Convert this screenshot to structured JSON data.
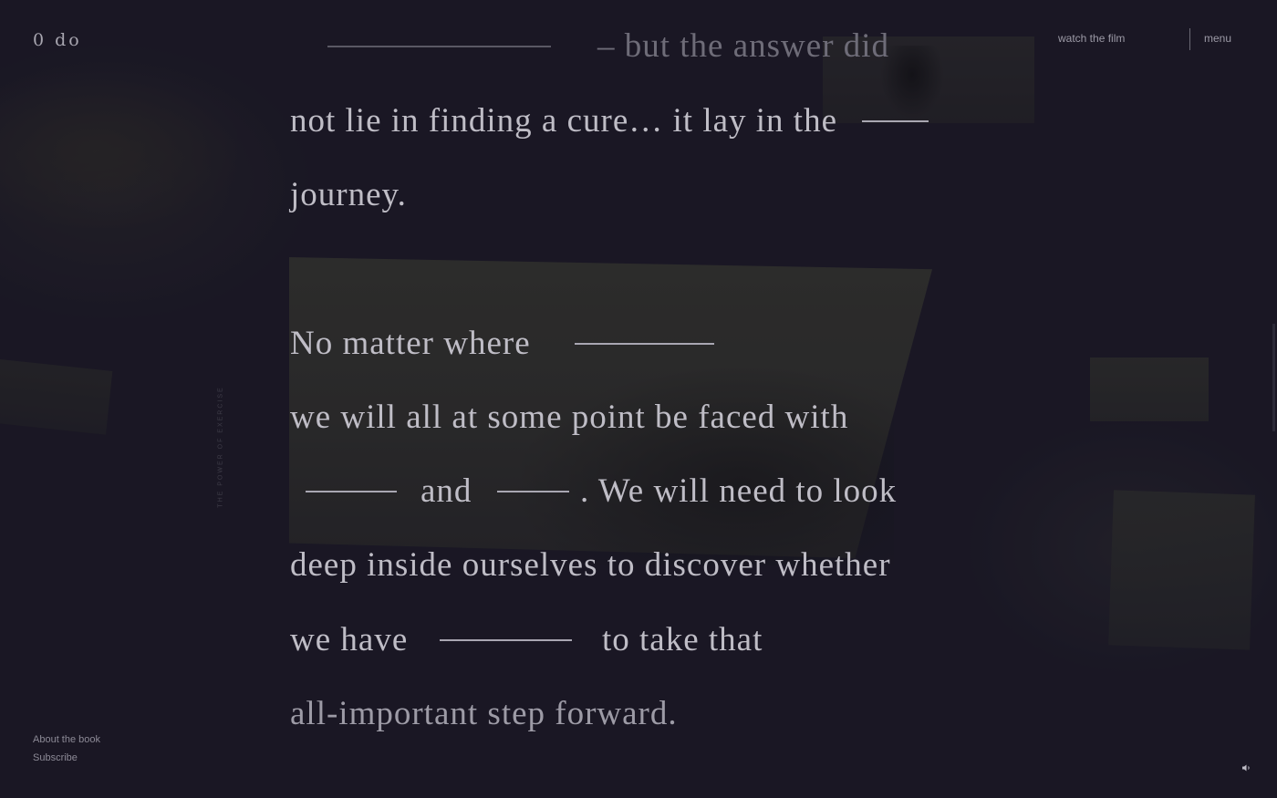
{
  "header": {
    "logo": "0 do",
    "watch_film": "watch the film",
    "menu": "menu"
  },
  "side_label": "THE POWER OF EXERCISE",
  "passage": {
    "line1_end": "– but the answer did",
    "line2": "not lie in finding a cure… it lay in the",
    "line3": "journey.",
    "line4": "No matter where",
    "line5": "we will all at some point be faced with",
    "line6_and": "and",
    "line6_rest": ". We will need to look",
    "line7": "deep inside ourselves to discover whether",
    "line8_start": "we have",
    "line8_end": "to take that",
    "line9": "all-important step forward."
  },
  "footer": {
    "about": "About the book",
    "subscribe": "Subscribe",
    "sound_icon": "speaker-icon"
  }
}
